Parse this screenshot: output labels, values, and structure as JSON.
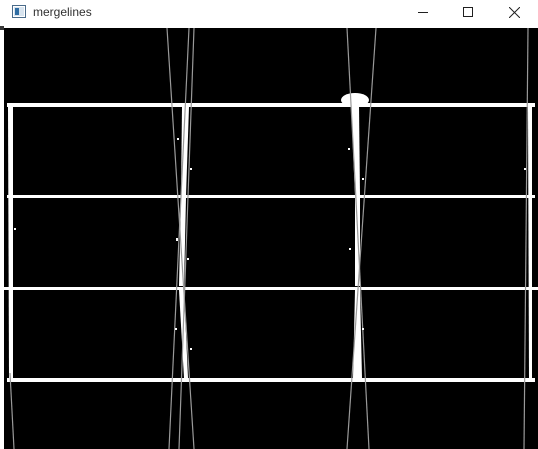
{
  "window": {
    "title": "mergelines"
  },
  "titlebar_icons": {
    "app": "opencv-window-icon",
    "minimize": "minimize-icon",
    "maximize": "maximize-icon",
    "close": "close-icon"
  },
  "image": {
    "description_kind": "binary-image",
    "background_color": "#000000",
    "line_color": "#ffffff"
  }
}
